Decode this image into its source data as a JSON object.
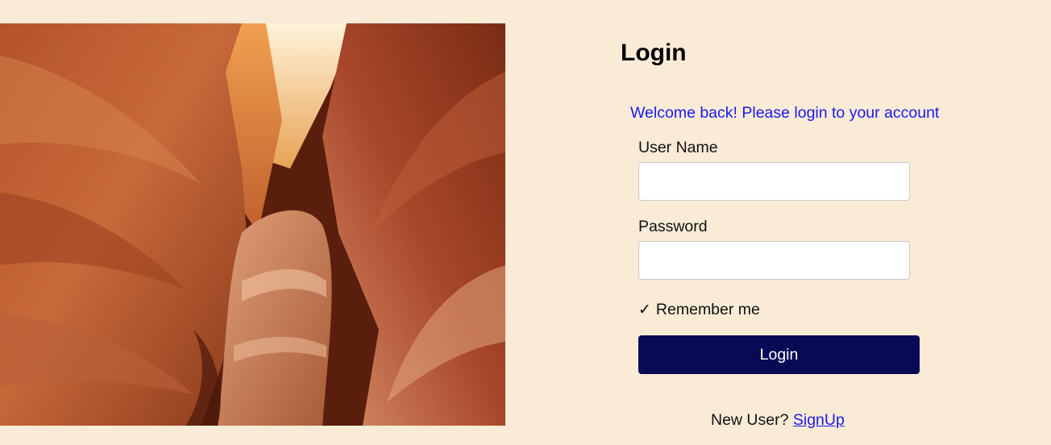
{
  "hero": {
    "image_icon": "canyon-photo"
  },
  "login_form": {
    "title": "Login",
    "welcome": "Welcome back! Please login to your account",
    "username_label": "User Name",
    "username_value": "",
    "password_label": "Password",
    "password_value": "",
    "remember_check_icon": "✓",
    "remember_label": "Remember me",
    "submit_label": "Login",
    "signup_prompt": "New User?",
    "signup_link": "SignUp"
  },
  "colors": {
    "background": "#faebd7",
    "accent_text": "#1a1aee",
    "button": "#080a55",
    "button_text": "#ffffff"
  }
}
